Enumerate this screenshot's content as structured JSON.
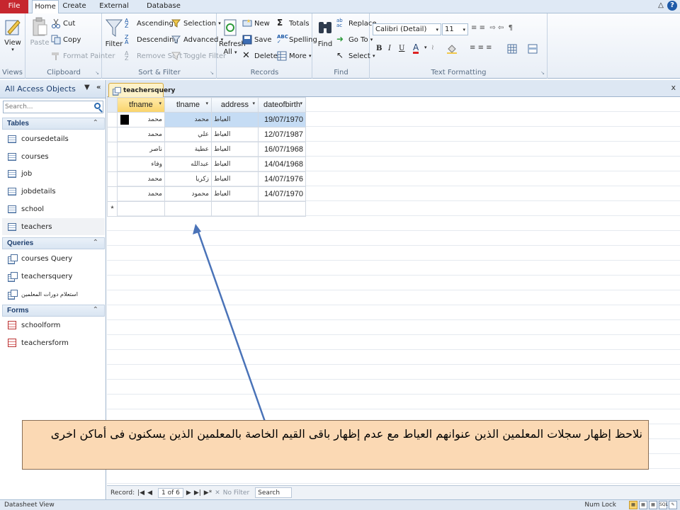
{
  "ribbon_tabs": [
    "File",
    "Home",
    "Create",
    "External Data",
    "Database Tools"
  ],
  "ribbon": {
    "views": {
      "view": "View",
      "group": "Views"
    },
    "clipboard": {
      "paste": "Paste",
      "cut": "Cut",
      "copy": "Copy",
      "format_painter": "Format Painter",
      "group": "Clipboard"
    },
    "sort_filter": {
      "filter": "Filter",
      "ascending": "Ascending",
      "descending": "Descending",
      "remove_sort": "Remove Sort",
      "selection": "Selection",
      "advanced": "Advanced",
      "toggle_filter": "Toggle Filter",
      "group": "Sort & Filter"
    },
    "records": {
      "refresh": "Refresh",
      "refresh_all": "All",
      "new": "New",
      "save": "Save",
      "delete": "Delete",
      "totals": "Totals",
      "spelling": "Spelling",
      "more": "More",
      "group": "Records"
    },
    "find": {
      "find": "Find",
      "replace": "Replace",
      "go_to": "Go To",
      "select": "Select",
      "group": "Find"
    },
    "text_formatting": {
      "font": "Calibri (Detail)",
      "size": "11",
      "bold": "B",
      "italic": "I",
      "underline": "U",
      "font_color": "A",
      "group": "Text Formatting"
    }
  },
  "nav": {
    "title": "All Access Objects",
    "search_placeholder": "Search...",
    "sections": [
      {
        "name": "Tables",
        "items": [
          "coursedetails",
          "courses",
          "job",
          "jobdetails",
          "school",
          "teachers"
        ]
      },
      {
        "name": "Queries",
        "items": [
          "courses Query",
          "teachersquery",
          "استعلام دورات المعلمين"
        ]
      },
      {
        "name": "Forms",
        "items": [
          "schoolform",
          "teachersform"
        ]
      }
    ]
  },
  "document": {
    "tab": "teachersquery",
    "columns": [
      "tfname",
      "tlname",
      "address",
      "dateofbirth"
    ],
    "rows": [
      [
        "محمد",
        "محمد",
        "العياط",
        "19/07/1970"
      ],
      [
        "محمد",
        "علي",
        "العياط",
        "12/07/1987"
      ],
      [
        "ناصر",
        "عطية",
        "العياط",
        "16/07/1968"
      ],
      [
        "وفاء",
        "عبدالله",
        "العياط",
        "14/04/1968"
      ],
      [
        "محمد",
        "زكريا",
        "العياط",
        "14/07/1976"
      ],
      [
        "محمد",
        "محمود",
        "العياط",
        "14/07/1970"
      ]
    ],
    "new_row_marker": "*"
  },
  "callout": "نلاحظ إظهار سجلات المعلمين الذين عنوانهم العياط مع عدم إظهار باقى القيم الخاصة بالمعلمين الذين يسكنون فى أماكن اخرى",
  "record_nav": {
    "label": "Record:",
    "position": "1 of 6",
    "filter": "No Filter",
    "search": "Search"
  },
  "status": {
    "left": "Datasheet View",
    "right": "Num Lock"
  },
  "colors": {
    "file_tab": "#c6262e",
    "callout_bg": "#fbd9b4",
    "selected_row": "#c5dcf4",
    "arrow": "#4a73b8"
  }
}
